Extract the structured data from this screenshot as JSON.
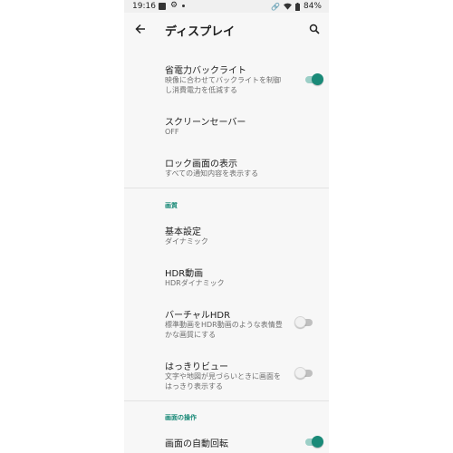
{
  "status_bar": {
    "time": "19:16",
    "battery": "84%",
    "icons": [
      "image-icon",
      "gear-icon",
      "link-icon",
      "wifi-icon",
      "battery-icon"
    ]
  },
  "app_bar": {
    "title": "ディスプレイ"
  },
  "settings": [
    {
      "title": "省電力バックライト",
      "subtitle": "映像に合わせてバックライトを制御し消費電力を低減する",
      "toggle": "on"
    },
    {
      "title": "スクリーンセーバー",
      "subtitle": "OFF"
    },
    {
      "title": "ロック画面の表示",
      "subtitle": "すべての通知内容を表示する"
    }
  ],
  "section_picture": {
    "header": "画質",
    "items": [
      {
        "title": "基本設定",
        "subtitle": "ダイナミック"
      },
      {
        "title": "HDR動画",
        "subtitle": "HDRダイナミック"
      },
      {
        "title": "バーチャルHDR",
        "subtitle": "標準動画をHDR動画のような表情豊かな画質にする",
        "toggle": "off"
      },
      {
        "title": "はっきりビュー",
        "subtitle": "文字や地図が見づらいときに画面をはっきり表示する",
        "toggle": "off"
      }
    ]
  },
  "section_operation": {
    "header": "画面の操作",
    "items": [
      {
        "title": "画面の自動回転",
        "toggle": "on"
      }
    ]
  },
  "colors": {
    "accent": "#1a8a78",
    "background": "#f7f7f7"
  }
}
